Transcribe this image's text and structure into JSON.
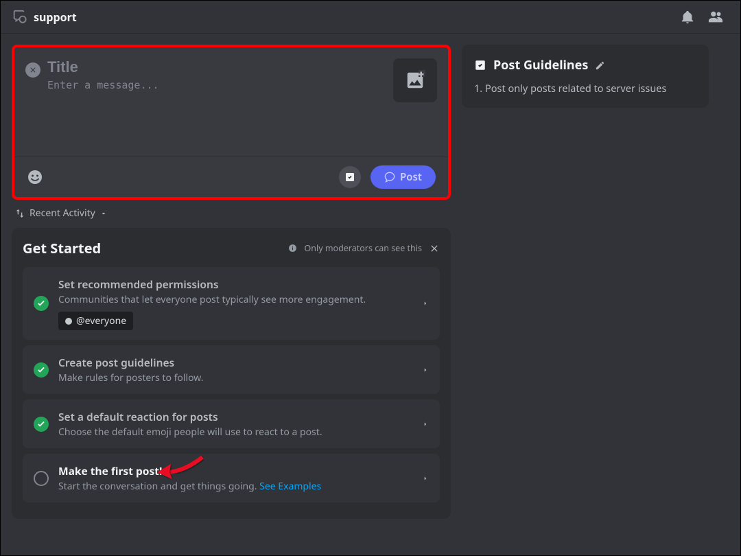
{
  "topbar": {
    "channel_name": "support"
  },
  "compose": {
    "title_placeholder": "Title",
    "message_placeholder": "Enter a message...",
    "post_label": "Post"
  },
  "sort": {
    "label": "Recent Activity"
  },
  "get_started": {
    "title": "Get Started",
    "moderator_note": "Only moderators can see this",
    "tasks": [
      {
        "done": true,
        "title": "Set recommended permissions",
        "desc": "Communities that let everyone post typically see more engagement.",
        "mention": "@everyone"
      },
      {
        "done": true,
        "title": "Create post guidelines",
        "desc": "Make rules for posters to follow."
      },
      {
        "done": true,
        "title": "Set a default reaction for posts",
        "desc": "Choose the default emoji people will use to react to a post."
      },
      {
        "done": false,
        "title": "Make the first post!",
        "desc_prefix": "Start the conversation and get things going. ",
        "link_text": "See Examples"
      }
    ]
  },
  "guidelines": {
    "title": "Post Guidelines",
    "items": [
      "1. Post only posts related to server issues"
    ]
  }
}
